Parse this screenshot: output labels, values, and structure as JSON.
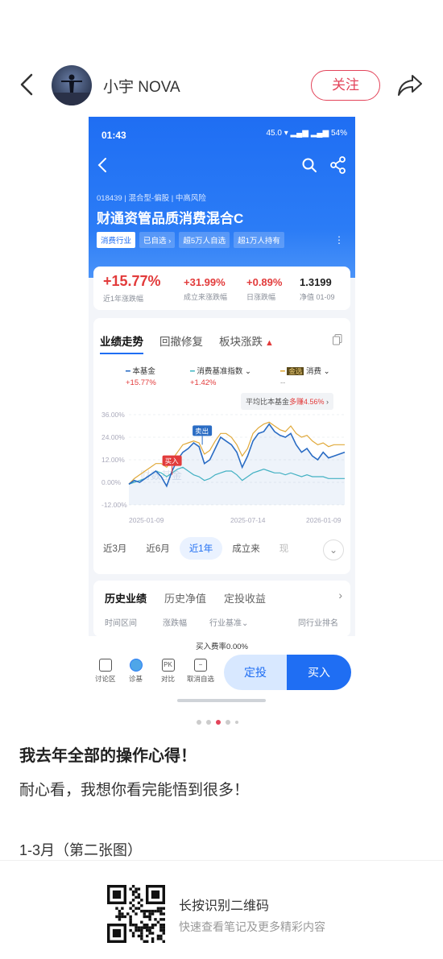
{
  "post": {
    "username": "小宇 NOVA",
    "follow_label": "关注",
    "title": "我去年全部的操作心得！",
    "paragraph1": "耐心看，我想你看完能悟到很多！",
    "paragraph2": "1-3月（第二张图）",
    "qr_title": "长按识别二维码",
    "qr_subtitle": "快速查看笔记及更多精彩内容",
    "carousel_active_index": 2
  },
  "phone": {
    "status_time": "01:43",
    "status_right": "45.0 ▾ ▂▄▆ ▂▄▆ 54%",
    "fund_meta": "018439 | 混合型-偏股 | 中高风险",
    "fund_name": "财通资管品质消费混合C",
    "tags": [
      "消费行业",
      "已自选 ›",
      "超5万人自选",
      "超1万人持有"
    ],
    "stats": [
      {
        "value": "+15.77%",
        "label": "近1年涨跌幅"
      },
      {
        "value": "+31.99%",
        "label": "成立来涨跌幅"
      },
      {
        "value": "+0.89%",
        "label": "日涨跌幅"
      },
      {
        "value": "1.3199",
        "label": "净值 01-09"
      }
    ],
    "chart_tabs": [
      "业绩走势",
      "回撤修复",
      "板块涨跌"
    ],
    "legend": [
      {
        "name": "本基金",
        "change": "+15.77%",
        "color": "#2a6cc4"
      },
      {
        "name": "消费基准指数 ⌄",
        "change": "+1.42%",
        "color": "#46b8c4"
      },
      {
        "name": "消费 ⌄",
        "badge": "金选",
        "change": "--",
        "color": "#e0a93a"
      }
    ],
    "avg_badge_prefix": "平均比本基金",
    "avg_badge_highlight": "多赚4.56%",
    "avg_badge_suffix": " ›",
    "ranges": [
      "近3月",
      "近6月",
      "近1年",
      "成立来",
      "现"
    ],
    "range_active": "近1年",
    "hist_tabs": [
      "历史业绩",
      "历史净值",
      "定投收益"
    ],
    "hist_cols": [
      "时间区间",
      "涨跌幅",
      "行业基准⌄",
      "同行业排名"
    ],
    "fee_label": "买入费率0.00%",
    "tools": [
      "讨论区",
      "诊基",
      "对比",
      "取消自选"
    ],
    "ding_label": "定投",
    "buy_label": "买入"
  },
  "chart_data": {
    "type": "line",
    "x_ticks": [
      "2025-01-09",
      "2025-07-14",
      "2026-01-09"
    ],
    "y_ticks": [
      "36.00%",
      "24.00%",
      "12.00%",
      "0.00%",
      "-12.00%"
    ],
    "ylim": [
      -12,
      36
    ],
    "watermark": "财数基金",
    "markers": [
      {
        "label": "买入",
        "x": 0.2,
        "y": 4
      },
      {
        "label": "卖出",
        "x": 0.34,
        "y": 20
      }
    ],
    "series": [
      {
        "name": "本基金",
        "color": "#2a6cc4",
        "values": [
          -1,
          1,
          0,
          2,
          4,
          6,
          3,
          -2,
          6,
          12,
          16,
          18,
          21,
          19,
          10,
          12,
          18,
          24,
          22,
          20,
          16,
          8,
          14,
          22,
          26,
          27,
          31,
          27,
          25,
          24,
          26,
          20,
          16,
          18,
          14,
          12,
          16,
          13,
          14,
          15,
          16
        ]
      },
      {
        "name": "消费基准指数",
        "color": "#46b8c4",
        "values": [
          -1,
          0,
          1,
          2,
          4,
          6,
          5,
          3,
          5,
          7,
          8,
          6,
          4,
          3,
          1,
          2,
          4,
          5,
          6,
          6,
          4,
          1,
          3,
          5,
          6,
          7,
          6,
          5,
          5,
          4,
          5,
          4,
          3,
          4,
          3,
          3,
          3,
          2,
          2,
          2,
          2
        ]
      },
      {
        "name": "消费",
        "color": "#e0a93a",
        "values": [
          -1,
          2,
          4,
          6,
          8,
          10,
          10,
          8,
          12,
          16,
          20,
          21,
          22,
          21,
          15,
          17,
          22,
          26,
          26,
          24,
          20,
          14,
          18,
          26,
          29,
          31,
          32,
          30,
          28,
          27,
          30,
          26,
          24,
          25,
          22,
          20,
          21,
          19,
          20,
          20,
          20
        ]
      }
    ]
  }
}
